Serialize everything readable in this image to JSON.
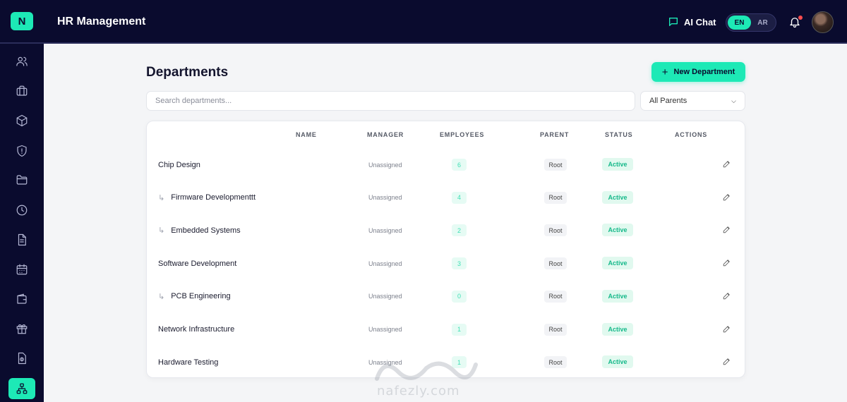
{
  "header": {
    "logo_letter": "N",
    "app_title": "HR Management",
    "ai_chat_label": "AI Chat",
    "languages": [
      {
        "code": "EN",
        "active": true
      },
      {
        "code": "AR",
        "active": false
      }
    ],
    "accent_color": "#1de9b6",
    "nav_bg_color": "#0a0b2e",
    "notification_dot_color": "#ff4d4f"
  },
  "sidebar": {
    "items": [
      {
        "icon": "users-icon",
        "active": false
      },
      {
        "icon": "briefcase-icon",
        "active": false
      },
      {
        "icon": "package-icon",
        "active": false
      },
      {
        "icon": "shield-alert-icon",
        "active": false
      },
      {
        "icon": "folder-icon",
        "active": false
      },
      {
        "icon": "clock-icon",
        "active": false
      },
      {
        "icon": "document-icon",
        "active": false
      },
      {
        "icon": "calendar-icon",
        "active": false
      },
      {
        "icon": "wallet-icon",
        "active": false
      },
      {
        "icon": "gift-icon",
        "active": false
      },
      {
        "icon": "money-document-icon",
        "active": false
      },
      {
        "icon": "org-chart-icon",
        "active": true
      }
    ]
  },
  "page": {
    "title": "Departments",
    "new_button_label": "New Department",
    "search_placeholder": "Search departments...",
    "parent_filter_value": "All Parents"
  },
  "table": {
    "columns": {
      "name": "NAME",
      "manager": "MANAGER",
      "employees": "EMPLOYEES",
      "parent": "PARENT",
      "status": "STATUS",
      "actions": "ACTIONS"
    },
    "rows": [
      {
        "name": "Chip Design",
        "child": false,
        "manager": "Unassigned",
        "employees": "6",
        "parent": "Root",
        "status": "Active"
      },
      {
        "name": "Firmware Developmenttt",
        "child": true,
        "manager": "Unassigned",
        "employees": "4",
        "parent": "Root",
        "status": "Active"
      },
      {
        "name": "Embedded Systems",
        "child": true,
        "manager": "Unassigned",
        "employees": "2",
        "parent": "Root",
        "status": "Active"
      },
      {
        "name": "Software Development",
        "child": false,
        "manager": "Unassigned",
        "employees": "3",
        "parent": "Root",
        "status": "Active"
      },
      {
        "name": "PCB Engineering",
        "child": true,
        "manager": "Unassigned",
        "employees": "0",
        "parent": "Root",
        "status": "Active"
      },
      {
        "name": "Network Infrastructure",
        "child": false,
        "manager": "Unassigned",
        "employees": "1",
        "parent": "Root",
        "status": "Active"
      },
      {
        "name": "Hardware Testing",
        "child": false,
        "manager": "Unassigned",
        "employees": "1",
        "parent": "Root",
        "status": "Active"
      }
    ]
  },
  "watermark": {
    "text": "nafezly.com"
  }
}
